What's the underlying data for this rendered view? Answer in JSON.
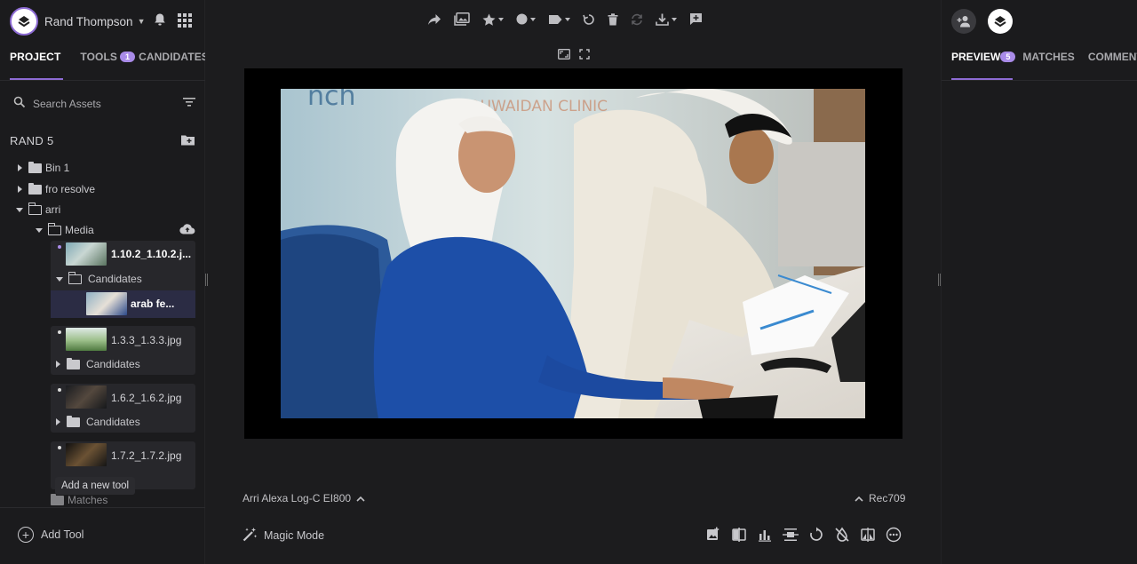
{
  "user": {
    "name": "Rand Thompson"
  },
  "tabs": [
    {
      "label": "PROJECT"
    },
    {
      "label": "TOOLS",
      "badge": "1"
    },
    {
      "label": "CANDIDATES"
    }
  ],
  "search": {
    "placeholder": "Search Assets"
  },
  "project": {
    "title": "RAND 5"
  },
  "tree": {
    "bin1": "Bin 1",
    "fro": "fro resolve",
    "arri": "arri",
    "media": "Media"
  },
  "cards": [
    {
      "name": "1.10.2_1.10.2.j...",
      "sub": "Candidates",
      "candidate": "arab fe..."
    },
    {
      "name": "1.3.3_1.3.3.jpg",
      "sub": "Candidates"
    },
    {
      "name": "1.6.2_1.6.2.jpg",
      "sub": "Candidates"
    },
    {
      "name": "1.7.2_1.7.2.jpg",
      "sub": "Candidates"
    }
  ],
  "tooltip": "Add a new tool",
  "matches_folder": "Matches",
  "add_tool": "Add Tool",
  "viewer": {
    "input_colorspace": "Arri Alexa Log-C EI800",
    "output_colorspace": "Rec709",
    "magic_mode": "Magic Mode"
  },
  "right_tabs": [
    {
      "label": "PREVIEW",
      "badge": "5"
    },
    {
      "label": "MATCHES"
    },
    {
      "label": "COMMENTS"
    }
  ],
  "colors": {
    "accent": "#8d6bd4",
    "badge": "#a98be8",
    "bg": "#1b1b1d"
  }
}
